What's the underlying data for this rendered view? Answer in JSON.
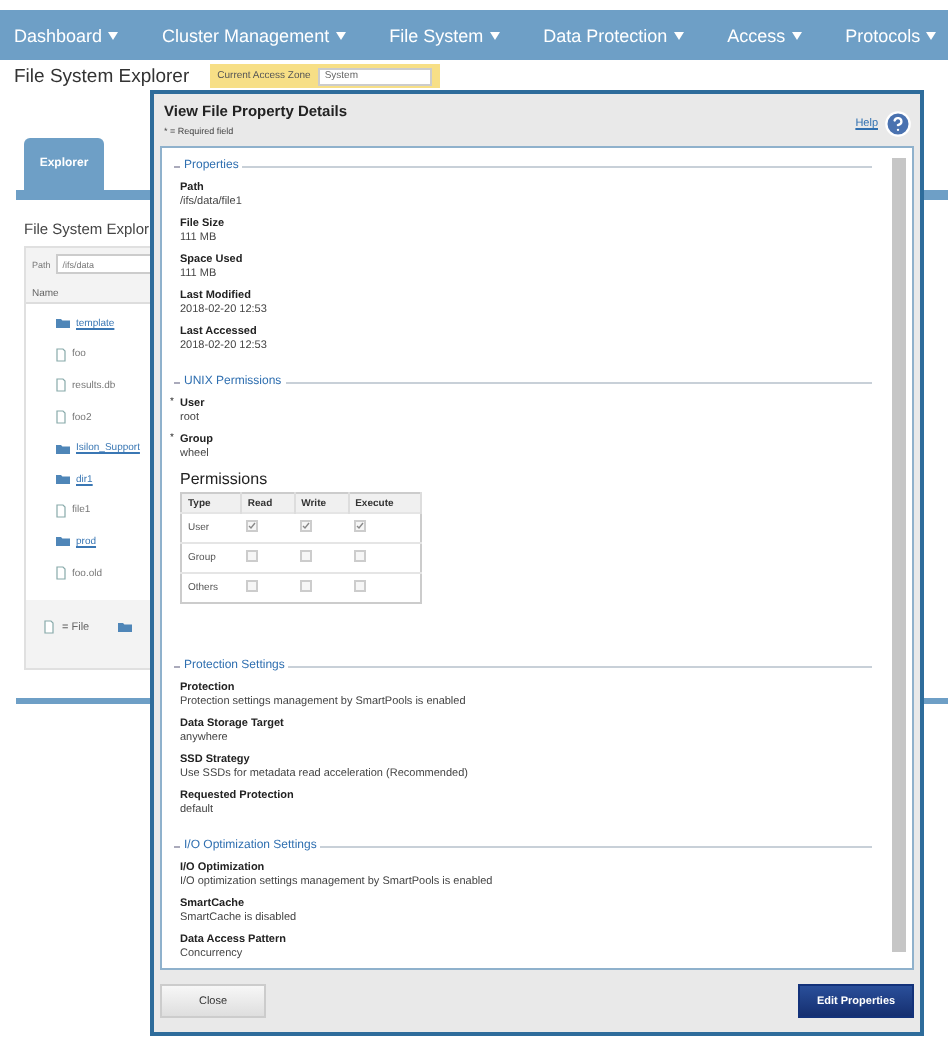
{
  "nav": [
    {
      "label": "Dashboard"
    },
    {
      "label": "Cluster Management"
    },
    {
      "label": "File System"
    },
    {
      "label": "Data Protection"
    },
    {
      "label": "Access"
    },
    {
      "label": "Protocols"
    }
  ],
  "page_title": "File System Explorer",
  "access_zone": {
    "label": "Current Access Zone",
    "value": "System"
  },
  "tabs": [
    {
      "label": "Explorer",
      "selected": true
    }
  ],
  "explorer": {
    "heading": "File System Explor",
    "path_label": "Path",
    "path_value": "/ifs/data",
    "column": "Name",
    "files": [
      {
        "name": "template",
        "kind": "folder"
      },
      {
        "name": "foo",
        "kind": "file"
      },
      {
        "name": "results.db",
        "kind": "file"
      },
      {
        "name": "foo2",
        "kind": "file"
      },
      {
        "name": "Isilon_Support",
        "kind": "folder"
      },
      {
        "name": "dir1",
        "kind": "folder"
      },
      {
        "name": "file1",
        "kind": "file"
      },
      {
        "name": "prod",
        "kind": "folder"
      },
      {
        "name": "foo.old",
        "kind": "file"
      }
    ],
    "legend": [
      {
        "kind": "file",
        "label": "= File"
      },
      {
        "kind": "folder"
      }
    ]
  },
  "dialog": {
    "title": "View File Property Details",
    "required_note": "* = Required field",
    "help": "Help",
    "sections": [
      {
        "title": "Properties",
        "fields": [
          {
            "label": "Path",
            "value": "/ifs/data/file1"
          },
          {
            "label": "File Size",
            "value": "111 MB"
          },
          {
            "label": "Space Used",
            "value": "111 MB"
          },
          {
            "label": "Last Modified",
            "value": "2018-02-20 12:53"
          },
          {
            "label": "Last Accessed",
            "value": "2018-02-20 12:53"
          }
        ]
      },
      {
        "title": "UNIX Permissions",
        "fields": [
          {
            "label": "User",
            "value": "root",
            "required_mark": "*"
          },
          {
            "label": "Group",
            "value": "wheel",
            "required_mark": "*"
          }
        ],
        "permissions": {
          "heading": "Permissions",
          "columns": [
            "Type",
            "Read",
            "Write",
            "Execute"
          ],
          "rows": [
            {
              "type": "User",
              "cells": [
                {
                  "checked": true
                },
                {
                  "checked": true
                },
                {
                  "checked": true
                }
              ]
            },
            {
              "type": "Group",
              "cells": [
                {
                  "checked": false
                },
                {
                  "checked": false
                },
                {
                  "checked": false
                }
              ]
            },
            {
              "type": "Others",
              "cells": [
                {
                  "checked": false
                },
                {
                  "checked": false
                },
                {
                  "checked": false
                }
              ]
            }
          ]
        }
      },
      {
        "title": "Protection Settings",
        "fields": [
          {
            "label": "Protection",
            "value": "Protection settings management by SmartPools is enabled"
          },
          {
            "label": "Data Storage Target",
            "value": "anywhere"
          },
          {
            "label": "SSD Strategy",
            "value": "Use SSDs for metadata read acceleration (Recommended)"
          },
          {
            "label": "Requested Protection",
            "value": "default"
          }
        ]
      },
      {
        "title": "I/O Optimization Settings",
        "fields": [
          {
            "label": "I/O Optimization",
            "value": "I/O optimization settings management by SmartPools is enabled"
          },
          {
            "label": "SmartCache",
            "value": "SmartCache is disabled"
          },
          {
            "label": "Data Access Pattern",
            "value": "Concurrency"
          }
        ]
      }
    ],
    "buttons": [
      {
        "label": "Close",
        "kind": "secondary"
      },
      {
        "label": "Edit Properties",
        "kind": "primary"
      }
    ]
  }
}
